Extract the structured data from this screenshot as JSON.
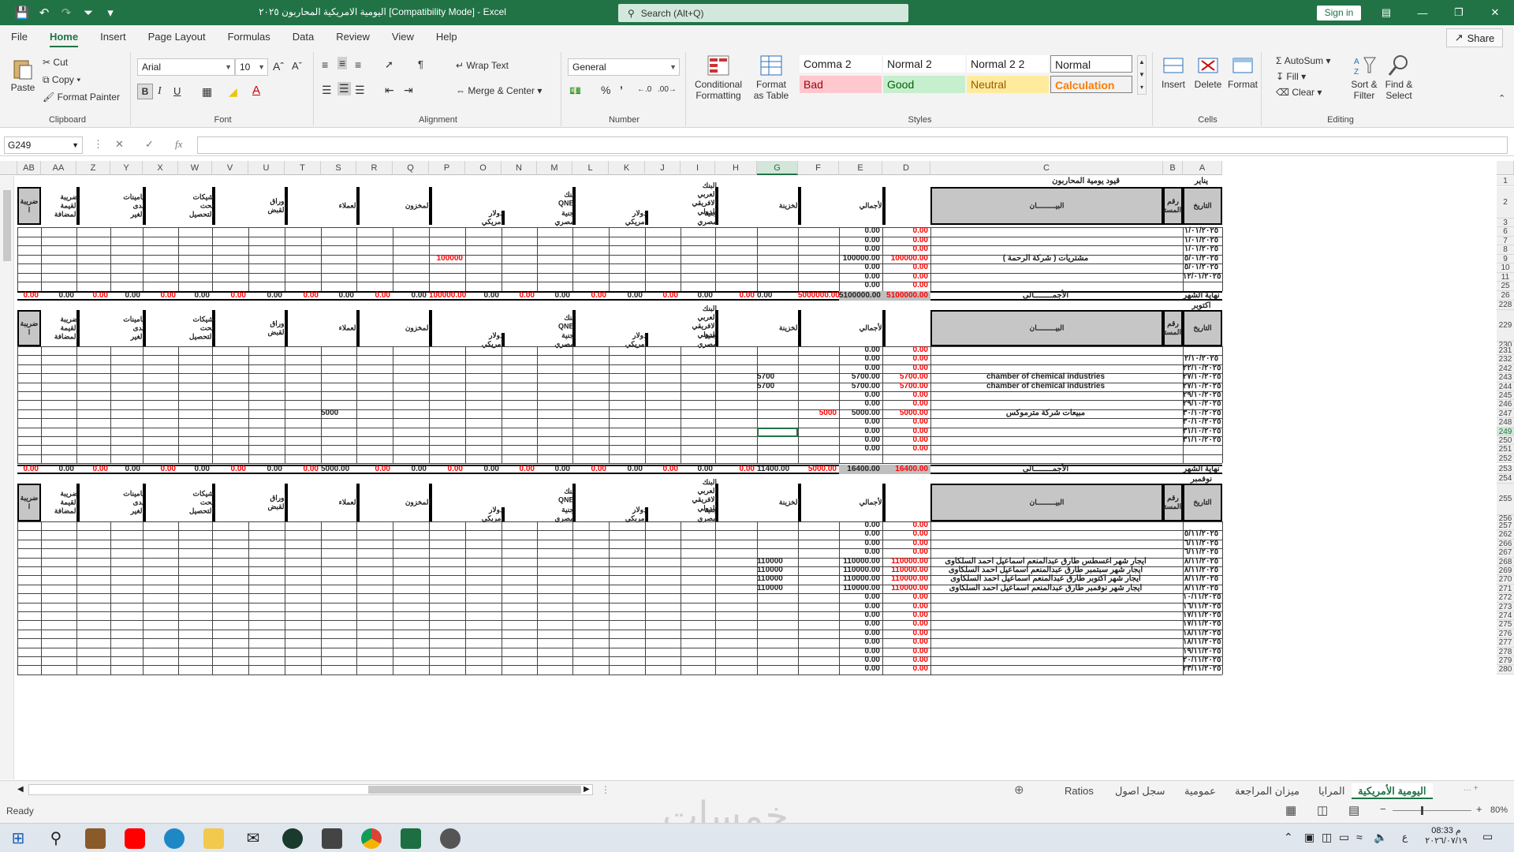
{
  "window": {
    "title": "اليومية الامريكية المحاربون ٢٠٢٥  [Compatibility Mode]  -  Excel",
    "search_placeholder": "Search (Alt+Q)",
    "signin": "Sign in"
  },
  "menu": [
    "File",
    "Home",
    "Insert",
    "Page Layout",
    "Formulas",
    "Data",
    "Review",
    "View",
    "Help"
  ],
  "share": "Share",
  "ribbon": {
    "clipboard": {
      "paste": "Paste",
      "cut": "Cut",
      "copy": "Copy",
      "format_painter": "Format Painter",
      "label": "Clipboard"
    },
    "font": {
      "name": "Arial",
      "size": "10",
      "label": "Font"
    },
    "alignment": {
      "wrap": "Wrap Text",
      "merge": "Merge & Center",
      "label": "Alignment"
    },
    "number": {
      "format": "General",
      "label": "Number"
    },
    "styles": {
      "conditional": "Conditional Formatting",
      "format_table": "Format as Table",
      "comma2": "Comma 2",
      "normal2": "Normal 2",
      "normal22": "Normal 2 2",
      "normal": "Normal",
      "bad": "Bad",
      "good": "Good",
      "neutral": "Neutral",
      "calculation": "Calculation",
      "label": "Styles"
    },
    "cells": {
      "insert": "Insert",
      "delete": "Delete",
      "format": "Format",
      "label": "Cells"
    },
    "editing": {
      "autosum": "AutoSum",
      "fill": "Fill",
      "clear": "Clear",
      "sort": "Sort & Filter",
      "find": "Find & Select",
      "label": "Editing"
    }
  },
  "formula_bar": {
    "name_box": "G249",
    "fx": "fx",
    "value": ""
  },
  "columns": [
    "AB",
    "AA",
    "Z",
    "Y",
    "X",
    "W",
    "V",
    "U",
    "T",
    "S",
    "R",
    "Q",
    "P",
    "O",
    "N",
    "M",
    "L",
    "K",
    "J",
    "I",
    "H",
    "G",
    "F",
    "E",
    "D",
    "C",
    "B",
    "A"
  ],
  "headers": {
    "date": "التاريخ",
    "doc": "رقم المستند",
    "desc": "البيـــــــــان",
    "total": "الأجمالي",
    "treasury": "الخزينة",
    "aaib": "البنك العربي الافريقي الدولي",
    "qnb": "بنك QNB",
    "egp": "جنية مصري",
    "usd": "دولار أمريكي",
    "inventory": "المخزون",
    "clients": "العملاء",
    "notes": "اوراق القبض",
    "cheques": "شيكات تحت التحصيل",
    "deposits": "تامينات لدى الغير",
    "vat": "ضريبة القيمة المضافة",
    "tax": "ضريبة ا"
  },
  "top_labels": {
    "r1a": "يناير",
    "r1c": "قيود يومية المحاربون",
    "r228": "اكتوبر",
    "r254": "نوفمبر",
    "month_end": "نهاية الشهر",
    "totals": "الأجمــــــــالى"
  },
  "section1": {
    "rows": [
      {
        "row": "6",
        "date": "١/٠١/٢٠٢٥",
        "d": "0.00",
        "e": "0.00"
      },
      {
        "row": "7",
        "date": "١/٠١/٢٠٢٥",
        "d": "0.00",
        "e": "0.00"
      },
      {
        "row": "8",
        "date": "١/٠١/٢٠٢٥",
        "d": "0.00",
        "e": "0.00"
      },
      {
        "row": "9",
        "date": "٥/٠١/٢٠٢٥",
        "desc": "مشتريات  ( شركة الرحمة )",
        "d": "100000.00",
        "e": "100000.00",
        "p": "100000"
      },
      {
        "row": "10",
        "date": "٥/٠١/٢٠٢٥",
        "d": "0.00",
        "e": "0.00"
      },
      {
        "row": "11",
        "date": "١٢/٠١/٢٠٢٥",
        "d": "0.00",
        "e": "0.00"
      },
      {
        "row": "25",
        "date": "",
        "d": "0.00",
        "e": "0.00"
      }
    ],
    "totals": {
      "d": "5100000.00",
      "e": "5100000.00",
      "f": "5000000.00",
      "g": "0.00",
      "p": "100000.00"
    }
  },
  "section2": {
    "rows": [
      {
        "row": "231",
        "date": "",
        "d": "0.00",
        "e": "0.00"
      },
      {
        "row": "232",
        "date": "٢/١٠/٢٠٢٥",
        "d": "0.00",
        "e": "0.00"
      },
      {
        "row": "242",
        "date": "٢٢/١٠/٢٠٢٥",
        "d": "0.00",
        "e": "0.00"
      },
      {
        "row": "243",
        "date": "٢٧/١٠/٢٠٢٥",
        "desc": "chamber of chemical industries",
        "d": "5700.00",
        "e": "5700.00",
        "g": "5700"
      },
      {
        "row": "244",
        "date": "٢٧/١٠/٢٠٢٥",
        "desc": "chamber of chemical industries",
        "d": "5700.00",
        "e": "5700.00",
        "g": "5700"
      },
      {
        "row": "245",
        "date": "٢٩/١٠/٢٠٢٥",
        "d": "0.00",
        "e": "0.00"
      },
      {
        "row": "246",
        "date": "٢٩/١٠/٢٠٢٥",
        "d": "0.00",
        "e": "0.00"
      },
      {
        "row": "247",
        "date": "٣٠/١٠/٢٠٢٥",
        "desc": "مبيعات شركة مترموكس",
        "d": "5000.00",
        "e": "5000.00",
        "f": "5000",
        "s": "5000"
      },
      {
        "row": "248",
        "date": "٣٠/١٠/٢٠٢٥",
        "d": "0.00",
        "e": "0.00"
      },
      {
        "row": "249",
        "date": "٣١/١٠/٢٠٢٥",
        "d": "0.00",
        "e": "0.00"
      },
      {
        "row": "250",
        "date": "٣١/١٠/٢٠٢٥",
        "d": "0.00",
        "e": "0.00"
      },
      {
        "row": "251",
        "date": "",
        "d": "0.00",
        "e": "0.00"
      },
      {
        "row": "252",
        "date": "",
        "d": "",
        "e": ""
      }
    ],
    "totals": {
      "d": "16400.00",
      "e": "16400.00",
      "f": "5000.00",
      "g": "11400.00",
      "p": "0.00",
      "s": "5000.00"
    }
  },
  "section3": {
    "rows": [
      {
        "row": "257",
        "date": "",
        "d": "0.00",
        "e": "0.00"
      },
      {
        "row": "262",
        "date": "٥/١١/٢٠٢٥",
        "d": "0.00",
        "e": "0.00"
      },
      {
        "row": "266",
        "date": "٦/١١/٢٠٢٥",
        "d": "0.00",
        "e": "0.00"
      },
      {
        "row": "267",
        "date": "٦/١١/٢٠٢٥",
        "d": "0.00",
        "e": "0.00"
      },
      {
        "row": "268",
        "date": "٨/١١/٢٠٢٥",
        "desc": "ايجار شهر اغسطس طارق عبدالمنعم اسماعيل احمد السلكاوى",
        "d": "110000.00",
        "e": "110000.00",
        "g": "110000"
      },
      {
        "row": "269",
        "date": "٨/١١/٢٠٢٥",
        "desc": "ايجار شهر سبتمبر طارق عبدالمنعم اسماعيل احمد السلكاوى",
        "d": "110000.00",
        "e": "110000.00",
        "g": "110000"
      },
      {
        "row": "270",
        "date": "٨/١١/٢٠٢٥",
        "desc": "ايجار شهر اكتوبر طارق عبدالمنعم اسماعيل احمد السلكاوى",
        "d": "110000.00",
        "e": "110000.00",
        "g": "110000"
      },
      {
        "row": "271",
        "date": "٨/١١/٢٠٢٥",
        "desc": "ايجار شهر نوفمبر طارق عبدالمنعم اسماعيل احمد السلكاوى",
        "d": "110000.00",
        "e": "110000.00",
        "g": "110000"
      },
      {
        "row": "272",
        "date": "١٠/١١/٢٠٢٥",
        "d": "0.00",
        "e": "0.00"
      },
      {
        "row": "273",
        "date": "١٦/١١/٢٠٢٥",
        "d": "0.00",
        "e": "0.00"
      },
      {
        "row": "274",
        "date": "١٧/١١/٢٠٢٥",
        "d": "0.00",
        "e": "0.00"
      },
      {
        "row": "275",
        "date": "١٧/١١/٢٠٢٥",
        "d": "0.00",
        "e": "0.00"
      },
      {
        "row": "276",
        "date": "١٨/١١/٢٠٢٥",
        "d": "0.00",
        "e": "0.00"
      },
      {
        "row": "277",
        "date": "١٨/١١/٢٠٢٥",
        "d": "0.00",
        "e": "0.00"
      },
      {
        "row": "278",
        "date": "١٩/١١/٢٠٢٥",
        "d": "0.00",
        "e": "0.00"
      },
      {
        "row": "279",
        "date": "٢٠/١١/٢٠٢٥",
        "d": "0.00",
        "e": "0.00"
      },
      {
        "row": "280",
        "date": "٢٣/١١/٢٠٢٥",
        "d": "0.00",
        "e": "0.00"
      }
    ]
  },
  "row_numbers_misc": {
    "r1": "1",
    "r2": "2",
    "r3": "3",
    "r26": "26",
    "r228": "228",
    "r229": "229",
    "r230": "230",
    "r253": "253",
    "r254": "254",
    "r255": "255",
    "r256": "256"
  },
  "sheet_tabs": [
    "اليومية الأمريكية",
    "المرايا",
    "ميزان المراجعة",
    "عمومية",
    "سجل اصول",
    "Ratios"
  ],
  "status": {
    "ready": "Ready",
    "zoom": "80%"
  },
  "clock": {
    "time": "08:33 م",
    "date": "٢٠٢٦/٠٧/١٩",
    "lang": "ع"
  },
  "watermark": "خمسات",
  "colors": {
    "excel_green": "#217346",
    "header_gray": "#c6c6c6",
    "red": "#ff0000"
  }
}
